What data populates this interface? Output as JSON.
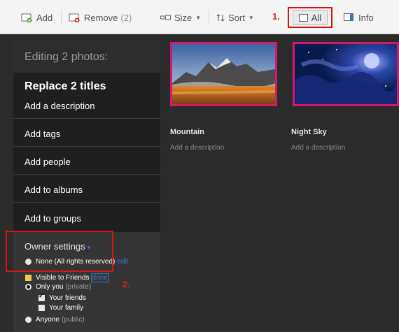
{
  "toolbar": {
    "add_label": "Add",
    "remove_label": "Remove",
    "remove_count": "(2)",
    "size_label": "Size",
    "sort_label": "Sort",
    "all_label": "All",
    "info_label": "Info",
    "annotation_1": "1."
  },
  "panel": {
    "heading": "Editing 2 photos:",
    "replace_titles": "Replace 2 titles",
    "add_description": "Add a description",
    "add_tags": "Add tags",
    "add_people": "Add people",
    "add_to_albums": "Add to albums",
    "add_to_groups": "Add to groups",
    "owner_settings": {
      "label": "Owner settings",
      "caret": "▾",
      "opt_none": "None (All rights reserved)",
      "opt_none_link": "edit",
      "visible_label": "Visible to Friends",
      "visible_link": "done",
      "only_you": "Only you",
      "only_you_note": "(private)",
      "your_friends": "Your friends",
      "your_family": "Your family",
      "anyone": "Anyone",
      "anyone_note": "(public)",
      "annotation_2": "2."
    }
  },
  "photos": [
    {
      "title": "Mountain",
      "description": "Add a description"
    },
    {
      "title": "Night Sky",
      "description": "Add a description"
    }
  ],
  "colors": {
    "selection_border": "#d4186c",
    "annotation_red": "#e21b1b",
    "link_blue": "#2f79d3"
  }
}
